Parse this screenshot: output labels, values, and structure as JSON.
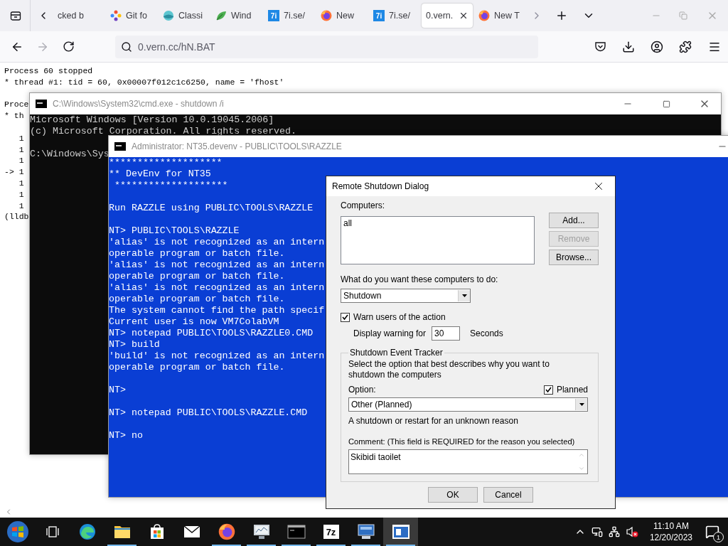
{
  "browser": {
    "tabs": [
      {
        "label": "cked b",
        "kind": "plain",
        "selected": false
      },
      {
        "label": "Git fo",
        "kind": "git",
        "selected": false
      },
      {
        "label": "Classi",
        "kind": "sphere",
        "selected": false
      },
      {
        "label": "Wind",
        "kind": "leaf",
        "selected": false
      },
      {
        "label": "7i.se/",
        "kind": "badge",
        "icon_label": "7i",
        "selected": false
      },
      {
        "label": "New",
        "kind": "firefox",
        "selected": false
      },
      {
        "label": "7i.se/",
        "kind": "badge",
        "icon_label": "7i",
        "selected": false
      },
      {
        "label": "0.vern.",
        "kind": "plain",
        "selected": true
      },
      {
        "label": "New T",
        "kind": "firefox",
        "selected": false
      }
    ],
    "address": "0.vern.cc/hN.BAT"
  },
  "page": {
    "blocks": [
      [
        "Process 60 stopped",
        "* thread #1: tid = 60, 0x00007f012c1c6250, name = 'fhost'"
      ],
      [
        "Proce",
        "* th"
      ],
      [
        "   1",
        "   1",
        "   1",
        "-> 1",
        "   1",
        "   1",
        "   1",
        "(lldb"
      ]
    ]
  },
  "cmd_window": {
    "title": "C:\\Windows\\System32\\cmd.exe - shutdown /i",
    "blocks": [
      [
        "Microsoft Windows [Version 10.0.19045.2006]",
        "(c) Microsoft Corporation. All rights reserved."
      ],
      [
        "C:\\Windows\\Sys"
      ]
    ]
  },
  "devenv_window": {
    "title": "Administrator: NT35.devenv - PUBLIC\\TOOLS\\RAZZLE",
    "blocks": [
      [
        "********************",
        "** DevEnv for NT35",
        " ********************"
      ],
      [
        "Run RAZZLE using PUBLIC\\TOOLS\\RAZZLE"
      ],
      [
        "NT> PUBLIC\\TOOLS\\RAZZLE",
        "'alias' is not recognized as an intern",
        "operable program or batch file.",
        "'alias' is not recognized as an intern",
        "operable program or batch file.",
        "'alias' is not recognized as an intern",
        "operable program or batch file.",
        "The system cannot find the path specif",
        "Current user is now VM7ColabVM",
        "NT> notepad PUBLIC\\TOOLS\\RAZZLE0.CMD",
        "NT> build",
        "'build' is not recognized as an intern",
        "operable program or batch file."
      ],
      [
        "NT>"
      ],
      [
        "NT> notepad PUBLIC\\TOOLS\\RAZZLE.CMD"
      ],
      [
        "NT> no"
      ]
    ]
  },
  "dialog": {
    "title": "Remote Shutdown Dialog",
    "computers_label": "Computers:",
    "computers": [
      "all"
    ],
    "side_buttons": [
      {
        "label": "Add...",
        "disabled": false
      },
      {
        "label": "Remove",
        "disabled": true
      },
      {
        "label": "Browse...",
        "disabled": false
      }
    ],
    "action_label": "What do you want these computers to do:",
    "action": "Shutdown",
    "warn": {
      "label": "Warn users of the action",
      "checked": true
    },
    "delay_label": "Display warning for",
    "delay": "30",
    "delay_unit": "Seconds",
    "tracker": {
      "title": "Shutdown Event Tracker",
      "description": "Select the option that best describes why you want to shutdown the computers",
      "option_label": "Option:",
      "planned": {
        "label": "Planned",
        "checked": true
      },
      "option": "Other (Planned)",
      "option_description": "A shutdown or restart for an unknown reason",
      "comment_label": "Comment: (This field is REQUIRED for the reason you selected)",
      "comment": "Skibidi taoilet"
    },
    "footer_buttons": [
      "OK",
      "Cancel"
    ]
  },
  "taskbar": {
    "apps": [
      {
        "kind": "start",
        "running": false,
        "selected": false
      },
      {
        "kind": "taskview",
        "running": false,
        "selected": false
      },
      {
        "kind": "edge",
        "running": false,
        "selected": false
      },
      {
        "kind": "folder",
        "running": true,
        "selected": false
      },
      {
        "kind": "store",
        "running": false,
        "selected": false
      },
      {
        "kind": "mail",
        "running": false,
        "selected": false
      },
      {
        "kind": "firefox",
        "running": true,
        "selected": false
      },
      {
        "kind": "monitor",
        "running": true,
        "selected": false
      },
      {
        "kind": "console",
        "running": true,
        "selected": false
      },
      {
        "kind": "archiver",
        "label": "7z",
        "running": true,
        "selected": false
      },
      {
        "kind": "computer",
        "running": true,
        "selected": false
      },
      {
        "kind": "window",
        "running": true,
        "selected": true
      }
    ],
    "time": "11:10 AM",
    "date": "12/20/2023",
    "notifications": "1"
  }
}
